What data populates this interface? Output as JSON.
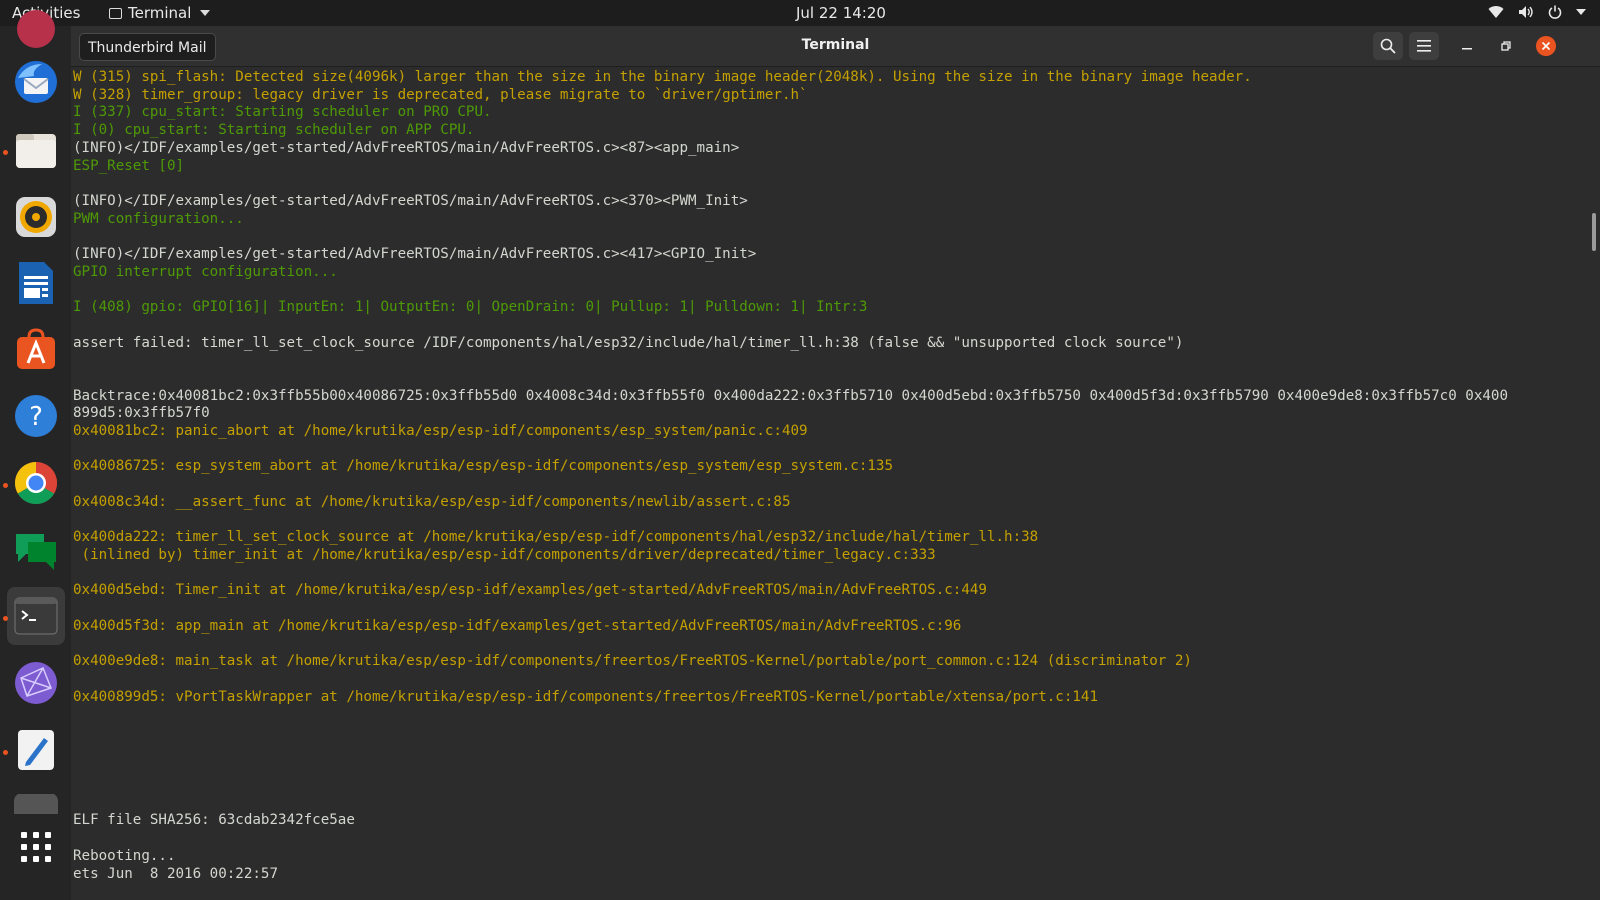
{
  "topbar": {
    "activities": "Activities",
    "app_name": "Terminal",
    "clock": "Jul 22  14:20"
  },
  "dock": {
    "items": [
      {
        "name": "Thunderbird Mail",
        "icon": "thunderbird-icon",
        "running": false
      },
      {
        "name": "Files",
        "icon": "files-icon",
        "running": true
      },
      {
        "name": "Rhythmbox",
        "icon": "rhythmbox-icon",
        "running": false
      },
      {
        "name": "LibreOffice Writer",
        "icon": "writer-icon",
        "running": false
      },
      {
        "name": "Ubuntu Software",
        "icon": "software-icon",
        "running": false
      },
      {
        "name": "Help",
        "icon": "help-icon",
        "running": false
      },
      {
        "name": "Google Chrome",
        "icon": "chrome-icon",
        "running": true
      },
      {
        "name": "Google Chat",
        "icon": "chat-icon",
        "running": false
      },
      {
        "name": "Terminal",
        "icon": "terminal-icon",
        "running": true,
        "active": true
      },
      {
        "name": "Network App",
        "icon": "network-icon",
        "running": false
      },
      {
        "name": "Text Editor",
        "icon": "text-editor-icon",
        "running": true
      },
      {
        "name": "Show Applications",
        "icon": "app-grid-icon",
        "running": false
      }
    ]
  },
  "window": {
    "title": "Terminal",
    "tooltip": "Thunderbird Mail"
  },
  "colors": {
    "yellow": "#c4a000",
    "green": "#4e9a06",
    "white": "#d3d7cf",
    "accent": "#e95420",
    "close": "#e95420"
  },
  "terminal": {
    "lines": [
      {
        "text": "W (315) spi_flash: Detected size(4096k) larger than the size in the binary image header(2048k). Using the size in the binary image header.",
        "color": "yellow"
      },
      {
        "text": "W (328) timer_group: legacy driver is deprecated, please migrate to `driver/gptimer.h`",
        "color": "yellow"
      },
      {
        "text": "I (337) cpu_start: Starting scheduler on PRO CPU.",
        "color": "green"
      },
      {
        "text": "I (0) cpu_start: Starting scheduler on APP CPU.",
        "color": "green"
      },
      {
        "text": "(INFO)</IDF/examples/get-started/AdvFreeRTOS/main/AdvFreeRTOS.c><87><app_main>",
        "color": "white"
      },
      {
        "text": "ESP_Reset [0]",
        "color": "green"
      },
      {
        "text": "",
        "color": "white"
      },
      {
        "text": "(INFO)</IDF/examples/get-started/AdvFreeRTOS/main/AdvFreeRTOS.c><370><PWM_Init>",
        "color": "white"
      },
      {
        "text": "PWM configuration...",
        "color": "green"
      },
      {
        "text": "",
        "color": "white"
      },
      {
        "text": "(INFO)</IDF/examples/get-started/AdvFreeRTOS/main/AdvFreeRTOS.c><417><GPIO_Init>",
        "color": "white"
      },
      {
        "text": "GPIO interrupt configuration...",
        "color": "green"
      },
      {
        "text": "",
        "color": "white"
      },
      {
        "text": "I (408) gpio: GPIO[16]| InputEn: 1| OutputEn: 0| OpenDrain: 0| Pullup: 1| Pulldown: 1| Intr:3",
        "color": "green"
      },
      {
        "text": "",
        "color": "white"
      },
      {
        "text": "assert failed: timer_ll_set_clock_source /IDF/components/hal/esp32/include/hal/timer_ll.h:38 (false && \"unsupported clock source\")",
        "color": "white"
      },
      {
        "text": "",
        "color": "white"
      },
      {
        "text": "",
        "color": "white"
      },
      {
        "text": "Backtrace:0x40081bc2:0x3ffb55b00x40086725:0x3ffb55d0 0x4008c34d:0x3ffb55f0 0x400da222:0x3ffb5710 0x400d5ebd:0x3ffb5750 0x400d5f3d:0x3ffb5790 0x400e9de8:0x3ffb57c0 0x400",
        "color": "white"
      },
      {
        "text": "899d5:0x3ffb57f0",
        "color": "white"
      },
      {
        "text": "0x40081bc2: panic_abort at /home/krutika/esp/esp-idf/components/esp_system/panic.c:409",
        "color": "yellow"
      },
      {
        "text": "",
        "color": "white"
      },
      {
        "text": "0x40086725: esp_system_abort at /home/krutika/esp/esp-idf/components/esp_system/esp_system.c:135",
        "color": "yellow"
      },
      {
        "text": "",
        "color": "white"
      },
      {
        "text": "0x4008c34d: __assert_func at /home/krutika/esp/esp-idf/components/newlib/assert.c:85",
        "color": "yellow"
      },
      {
        "text": "",
        "color": "white"
      },
      {
        "text": "0x400da222: timer_ll_set_clock_source at /home/krutika/esp/esp-idf/components/hal/esp32/include/hal/timer_ll.h:38",
        "color": "yellow"
      },
      {
        "text": " (inlined by) timer_init at /home/krutika/esp/esp-idf/components/driver/deprecated/timer_legacy.c:333",
        "color": "yellow"
      },
      {
        "text": "",
        "color": "white"
      },
      {
        "text": "0x400d5ebd: Timer_init at /home/krutika/esp/esp-idf/examples/get-started/AdvFreeRTOS/main/AdvFreeRTOS.c:449",
        "color": "yellow"
      },
      {
        "text": "",
        "color": "white"
      },
      {
        "text": "0x400d5f3d: app_main at /home/krutika/esp/esp-idf/examples/get-started/AdvFreeRTOS/main/AdvFreeRTOS.c:96",
        "color": "yellow"
      },
      {
        "text": "",
        "color": "white"
      },
      {
        "text": "0x400e9de8: main_task at /home/krutika/esp/esp-idf/components/freertos/FreeRTOS-Kernel/portable/port_common.c:124 (discriminator 2)",
        "color": "yellow"
      },
      {
        "text": "",
        "color": "white"
      },
      {
        "text": "0x400899d5: vPortTaskWrapper at /home/krutika/esp/esp-idf/components/freertos/FreeRTOS-Kernel/portable/xtensa/port.c:141",
        "color": "yellow"
      },
      {
        "text": "",
        "color": "white"
      },
      {
        "text": "",
        "color": "white"
      },
      {
        "text": "",
        "color": "white"
      },
      {
        "text": "",
        "color": "white"
      },
      {
        "text": "",
        "color": "white"
      },
      {
        "text": "",
        "color": "white"
      },
      {
        "text": "ELF file SHA256: 63cdab2342fce5ae",
        "color": "white"
      },
      {
        "text": "",
        "color": "white"
      },
      {
        "text": "Rebooting...",
        "color": "white"
      },
      {
        "text": "ets Jun  8 2016 00:22:57",
        "color": "white"
      }
    ]
  }
}
